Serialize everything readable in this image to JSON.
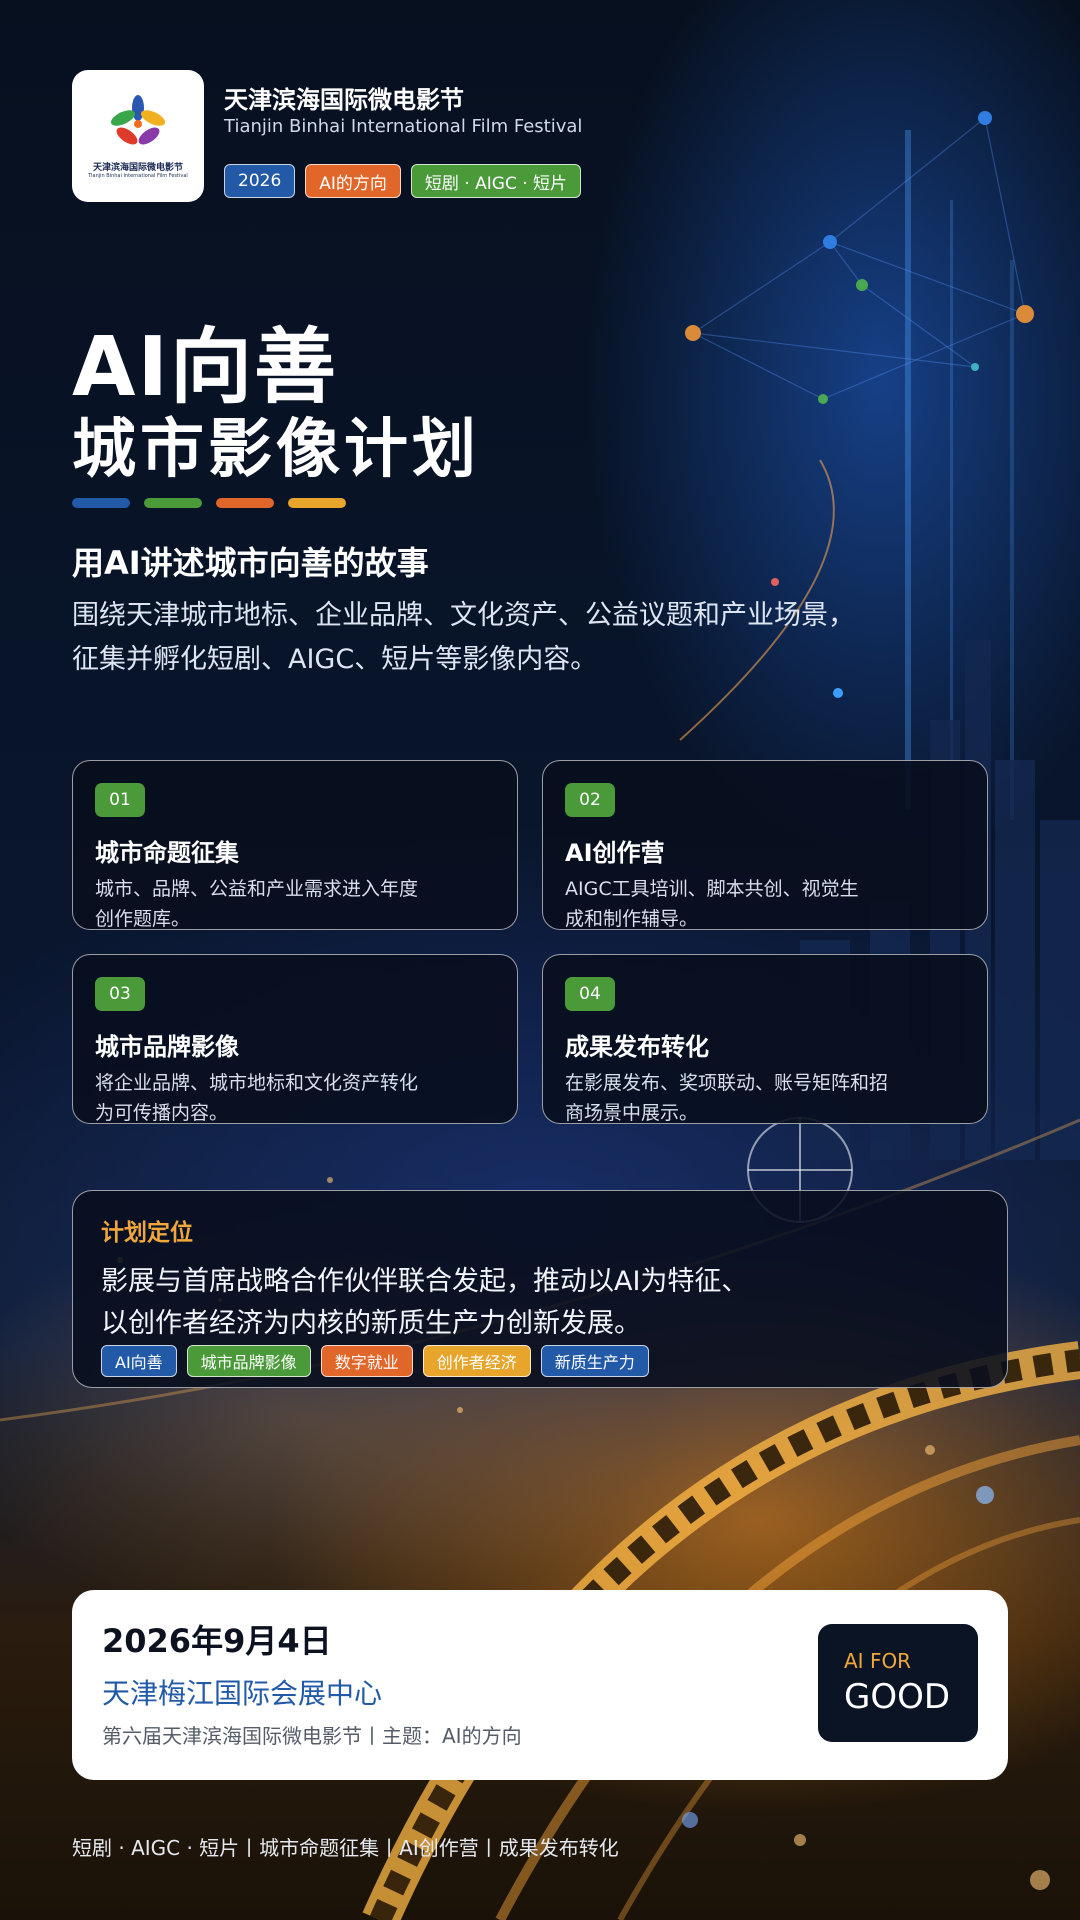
{
  "header": {
    "logo_text_cn": "天津滨海国际微电影节",
    "logo_text_en": "Tianjin Binhai International Film Festival",
    "title_cn": "天津滨海国际微电影节",
    "title_en": "Tianjin Binhai International Film Festival",
    "tags": [
      "2026",
      "AI的方向",
      "短剧 ·  AIGC ·  短片"
    ]
  },
  "hero": {
    "line1": "AI向善",
    "line2": "城市影像计划",
    "accent_colors": [
      "#225aa8",
      "#4a9a3a",
      "#e0662a",
      "#e7a52b"
    ]
  },
  "intro": {
    "subtitle": "用AI讲述城市向善的故事",
    "description_line1": "围绕天津城市地标、企业品牌、文化资产、公益议题和产业场景，",
    "description_line2": "征集并孵化短剧、AIGC、短片等影像内容。"
  },
  "cards": [
    {
      "num": "01",
      "title": "城市命题征集",
      "desc_line1": "城市、品牌、公益和产业需求进入年度",
      "desc_line2": "创作题库。"
    },
    {
      "num": "02",
      "title": "AI创作营",
      "desc_line1": "AIGC工具培训、脚本共创、视觉生",
      "desc_line2": "成和制作辅导。"
    },
    {
      "num": "03",
      "title": "城市品牌影像",
      "desc_line1": "将企业品牌、城市地标和文化资产转化",
      "desc_line2": "为可传播内容。"
    },
    {
      "num": "04",
      "title": "成果发布转化",
      "desc_line1": "在影展发布、奖项联动、账号矩阵和招",
      "desc_line2": "商场景中展示。"
    }
  ],
  "plan": {
    "title": "计划定位",
    "line1": "影展与首席战略合作伙伴联合发起，推动以AI为特征、",
    "line2": "以创作者经济为内核的新质生产力创新发展。",
    "tags": [
      "AI向善",
      "城市品牌影像",
      "数字就业",
      "创作者经济",
      "新质生产力"
    ]
  },
  "info": {
    "date": "2026年9月4日",
    "venue": "天津梅江国际会展中心",
    "theme": "第六届天津滨海国际微电影节丨主题：AI的方向",
    "badge_top": "AI FOR",
    "badge_bottom": "GOOD"
  },
  "footer": {
    "text": "短剧 ·   AIGC ·   短片丨城市命题征集丨AI创作营丨成果发布转化"
  }
}
